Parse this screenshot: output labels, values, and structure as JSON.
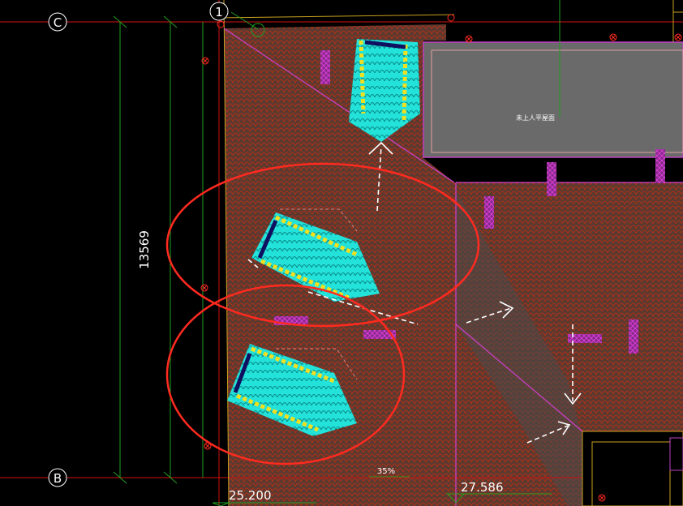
{
  "grid": {
    "axis_c": "C",
    "axis_b": "B",
    "axis_1": "1"
  },
  "dimensions": {
    "vertical": "13569"
  },
  "elevations": {
    "left": "25.200",
    "right": "27.586"
  },
  "room_label": "未上人平屋面",
  "slope_label": "35%",
  "colors": {
    "roof_fill": "#5a3a30",
    "tile_line": "#b03018",
    "grid_red": "#d01010",
    "grid_green": "#20a020",
    "magenta": "#c020c0",
    "cyan": "#20e0d8",
    "yellow": "#f0e020",
    "callout_red": "#ff2a20",
    "flat_roof": "#6a6a6a"
  }
}
